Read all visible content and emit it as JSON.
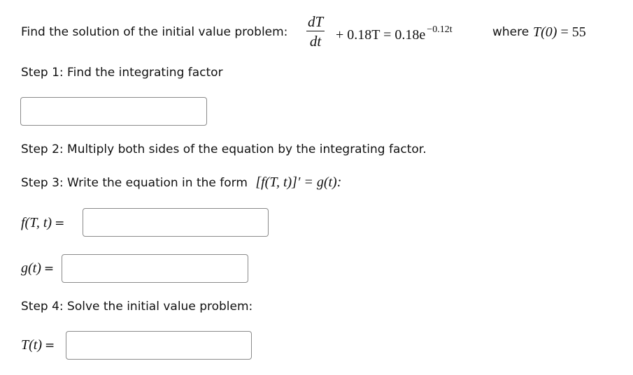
{
  "problem": {
    "prefix": "Find the solution of the initial value problem:",
    "frac_num": "dT",
    "frac_den": "dt",
    "eq_mid": "+ 0.18T = 0.18e",
    "eq_exp": "−0.12t",
    "where_label": "where",
    "init_lhs": "T(0)",
    "init_rhs": "= 55"
  },
  "step1": {
    "label": "Step 1: Find the integrating factor",
    "input_value": ""
  },
  "step2": {
    "label": "Step 2: Multiply both sides of the equation by the integrating factor."
  },
  "step3": {
    "label": "Step 3: Write the equation in the form",
    "form_expr": "[f(T, t)]′ = g(t):",
    "f_label": "f(T, t)",
    "f_input_value": "",
    "g_label": "g(t)",
    "g_input_value": ""
  },
  "step4": {
    "label": "Step 4: Solve the initial value problem:",
    "T_label": "T(t)",
    "T_input_value": ""
  },
  "common": {
    "equals": "="
  }
}
